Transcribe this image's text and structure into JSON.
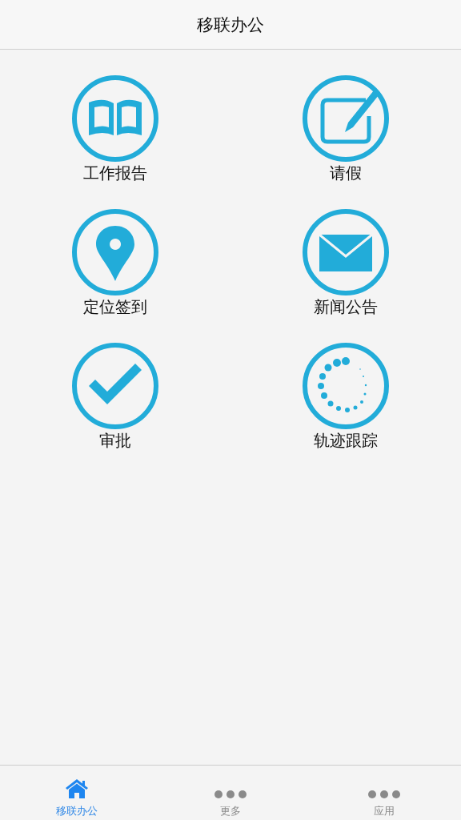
{
  "header": {
    "title": "移联办公"
  },
  "tiles": [
    {
      "label": "工作报告",
      "kind": "book"
    },
    {
      "label": "请假",
      "kind": "edit"
    },
    {
      "label": "定位签到",
      "kind": "pin"
    },
    {
      "label": "新闻公告",
      "kind": "mail"
    },
    {
      "label": "审批",
      "kind": "check"
    },
    {
      "label": "轨迹跟踪",
      "kind": "spinner"
    }
  ],
  "tab_bar": [
    {
      "label": "移联办公",
      "kind": "home",
      "selected": true
    },
    {
      "label": "更多",
      "kind": "dots",
      "selected": false
    },
    {
      "label": "应用",
      "kind": "dots",
      "selected": false
    }
  ]
}
